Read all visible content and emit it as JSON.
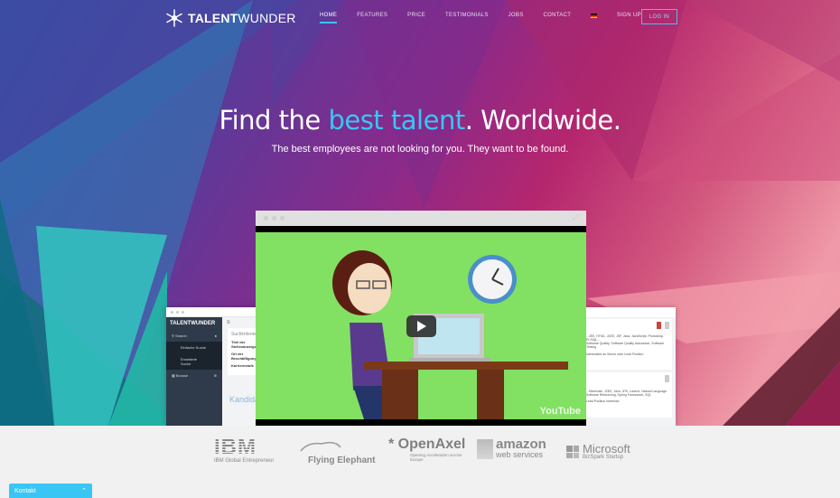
{
  "brand": {
    "name_bold": "TALENT",
    "name_light": "WUNDER"
  },
  "nav": {
    "items": [
      {
        "label": "Home",
        "active": true
      },
      {
        "label": "Features",
        "active": false
      },
      {
        "label": "Price",
        "active": false
      },
      {
        "label": "Testimonials",
        "active": false
      },
      {
        "label": "Jobs",
        "active": false
      },
      {
        "label": "Contact",
        "active": false
      }
    ],
    "language_flag": "de-flag-icon",
    "signup_label": "SIGN UP",
    "login_label": "LOG IN"
  },
  "hero": {
    "title_pre": "Find the ",
    "title_highlight": "best talent",
    "title_post": ". Worldwide.",
    "subtitle": "The best employees are not looking for you. They want to be found."
  },
  "left_app": {
    "brand": "TALENTWUNDER",
    "menu": [
      {
        "label": "Search",
        "icon": "search-icon"
      },
      {
        "label": "Einfache Suche"
      },
      {
        "label": "Erweiterte Suche"
      },
      {
        "label": "Browse",
        "icon": "grid-icon"
      }
    ],
    "card_title": "Suchkriterien",
    "card_fields": [
      "Titel der Stellenanzeige",
      "Ort der Beschäftigung",
      "Karrierestufe"
    ],
    "section_heading": "Kandidaten"
  },
  "right_app": {
    "cards": [
      {
        "skills": "...JEE, HTML, J2EE, JSF, Java, JavaScript, Photoshop, PL/SQL...",
        "line2": "Software Quality, Software Quality Assurance, Software Testing",
        "line3": "Interessiert an Senior oder Lead Position"
      },
      {
        "skills": "...Hibernate, J2EE, Java, JPA, Lucene, Natural Language",
        "line2": "Software Refactoring, Spring Framework, SQL",
        "line3": "Lead Position Interesse"
      }
    ]
  },
  "video": {
    "play_label": "Play video",
    "provider": "YouTube"
  },
  "partners": [
    {
      "name": "IBM",
      "caption": "IBM Global Entrepreneur"
    },
    {
      "name": "Flying Elephant",
      "caption": ""
    },
    {
      "name": "OpenAxel",
      "caption": "Opening Acceleration across Europe"
    },
    {
      "name": "amazon",
      "caption": "web services"
    },
    {
      "name": "Microsoft",
      "caption": "BizSpark Startup"
    }
  ],
  "kontakt": {
    "label": "Kontakt"
  },
  "colors": {
    "accent": "#39c6f4",
    "video_bg": "#82e062",
    "sidebar": "#2f3b4b"
  }
}
